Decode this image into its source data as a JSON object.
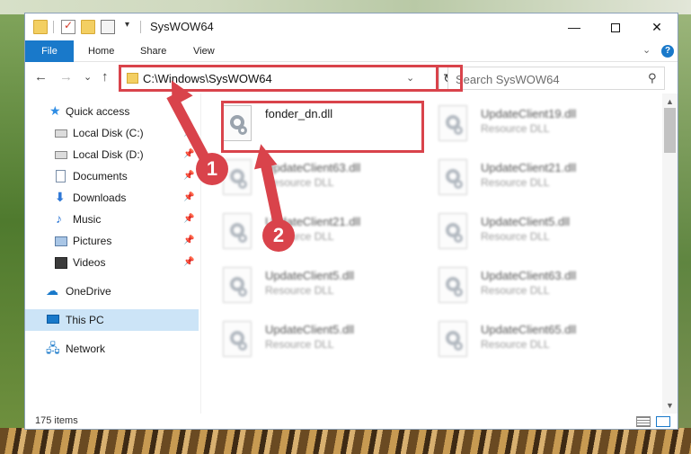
{
  "window": {
    "title": "SysWOW64",
    "quick_access_dropdown": "▾",
    "minimize": "—",
    "close": "✕"
  },
  "ribbon": {
    "tabs": [
      "File",
      "Home",
      "Share",
      "View"
    ],
    "collapse": "⌄",
    "help": "?"
  },
  "nav": {
    "back": "←",
    "forward": "→",
    "recent": "⌄",
    "up": "↑",
    "address": "C:\\Windows\\SysWOW64",
    "address_dropdown": "⌄",
    "refresh": "↻",
    "search_placeholder": "Search SysWOW64",
    "search_icon": "⚲"
  },
  "sidebar": {
    "items": [
      {
        "label": "Quick access",
        "icon": "star-icon",
        "pinned": false
      },
      {
        "label": "Local Disk (C:)",
        "icon": "drive-icon",
        "pinned": true
      },
      {
        "label": "Local Disk (D:)",
        "icon": "drive-icon",
        "pinned": true
      },
      {
        "label": "Documents",
        "icon": "documents-icon",
        "pinned": true
      },
      {
        "label": "Downloads",
        "icon": "downloads-icon",
        "pinned": true
      },
      {
        "label": "Music",
        "icon": "music-icon",
        "pinned": true
      },
      {
        "label": "Pictures",
        "icon": "pictures-icon",
        "pinned": true
      },
      {
        "label": "Videos",
        "icon": "videos-icon",
        "pinned": true
      },
      {
        "label": "OneDrive",
        "icon": "onedrive-icon",
        "pinned": false
      },
      {
        "label": "This PC",
        "icon": "this-pc-icon",
        "pinned": false,
        "selected": true
      },
      {
        "label": "Network",
        "icon": "network-icon",
        "pinned": false
      }
    ],
    "pin_glyph": "📌"
  },
  "files": [
    {
      "name": "fonder_dn.dll",
      "type": ""
    },
    {
      "name": "UpdateClient19.dll",
      "type": "Resource DLL"
    },
    {
      "name": "UpdateClient63.dll",
      "type": "Resource DLL"
    },
    {
      "name": "UpdateClient21.dll",
      "type": "Resource DLL"
    },
    {
      "name": "UpdateClient21.dll",
      "type": "Resource DLL"
    },
    {
      "name": "UpdateClient5.dll",
      "type": "Resource DLL"
    },
    {
      "name": "UpdateClient5.dll",
      "type": "Resource DLL"
    },
    {
      "name": "UpdateClient63.dll",
      "type": "Resource DLL"
    },
    {
      "name": "UpdateClient5.dll",
      "type": "Resource DLL"
    },
    {
      "name": "UpdateClient65.dll",
      "type": "Resource DLL"
    }
  ],
  "scrollbar": {
    "up": "▲",
    "down": "▼"
  },
  "status": {
    "item_count": "175 items"
  },
  "annotations": {
    "marker_1": "1",
    "marker_2": "2",
    "color": "#d9434b"
  },
  "colors": {
    "accent": "#1979ca",
    "selection": "#cce4f7"
  }
}
